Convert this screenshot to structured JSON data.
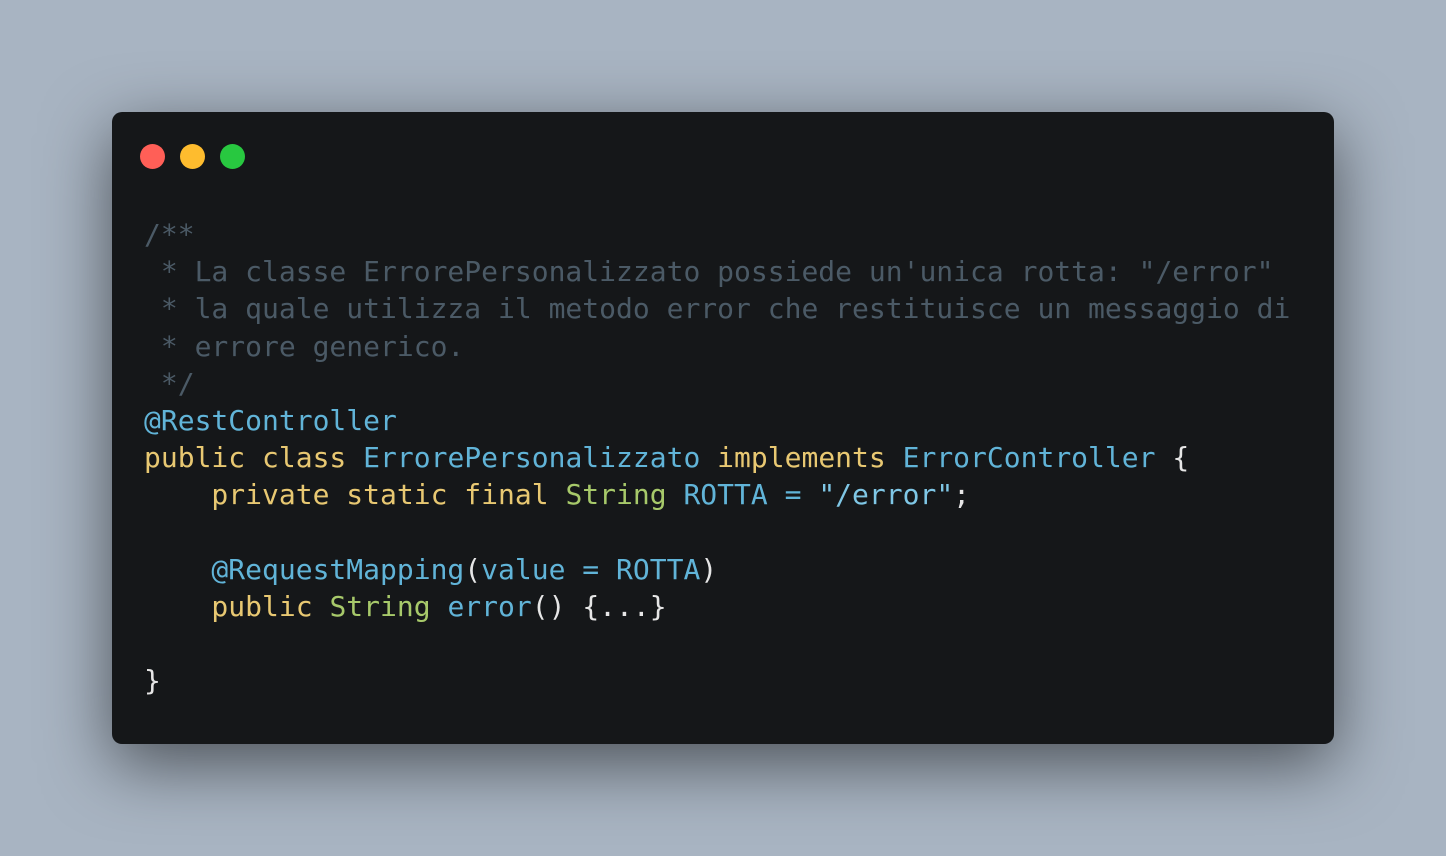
{
  "window": {
    "controls": [
      {
        "name": "close-dot",
        "color": "#ff5f57"
      },
      {
        "name": "minimize-dot",
        "color": "#febc2e"
      },
      {
        "name": "maximize-dot",
        "color": "#28c840"
      }
    ]
  },
  "colors": {
    "comment": "#4b5a66",
    "annotation": "#61b4d8",
    "keyword": "#e8c872",
    "type": "#a7c96a",
    "identifier": "#61b4d8",
    "plain": "#e6e6e6",
    "string": "#7fc7e6"
  },
  "code": {
    "lines": [
      [
        {
          "t": "/**",
          "c": "comment"
        }
      ],
      [
        {
          "t": " * La classe ErrorePersonalizzato possiede un'unica rotta: \"/error\"",
          "c": "comment"
        }
      ],
      [
        {
          "t": " * la quale utilizza il metodo error che restituisce un messaggio di",
          "c": "comment"
        }
      ],
      [
        {
          "t": " * errore generico.",
          "c": "comment"
        }
      ],
      [
        {
          "t": " */",
          "c": "comment"
        }
      ],
      [
        {
          "t": "@RestController",
          "c": "annotation"
        }
      ],
      [
        {
          "t": "public class ",
          "c": "keyword"
        },
        {
          "t": "ErrorePersonalizzato ",
          "c": "identifier"
        },
        {
          "t": "implements ",
          "c": "keyword"
        },
        {
          "t": "ErrorController ",
          "c": "identifier"
        },
        {
          "t": "{",
          "c": "plain"
        }
      ],
      [
        {
          "t": "    private static final ",
          "c": "keyword"
        },
        {
          "t": "String ",
          "c": "type"
        },
        {
          "t": "ROTTA = ",
          "c": "identifier"
        },
        {
          "t": "\"/error\"",
          "c": "string"
        },
        {
          "t": ";",
          "c": "plain"
        }
      ],
      [],
      [
        {
          "t": "    @RequestMapping",
          "c": "annotation"
        },
        {
          "t": "(",
          "c": "plain"
        },
        {
          "t": "value = ROTTA",
          "c": "identifier"
        },
        {
          "t": ")",
          "c": "plain"
        }
      ],
      [
        {
          "t": "    public ",
          "c": "keyword"
        },
        {
          "t": "String ",
          "c": "type"
        },
        {
          "t": "error",
          "c": "identifier"
        },
        {
          "t": "() {...}",
          "c": "plain"
        }
      ],
      [],
      [
        {
          "t": "}",
          "c": "plain"
        }
      ]
    ]
  }
}
